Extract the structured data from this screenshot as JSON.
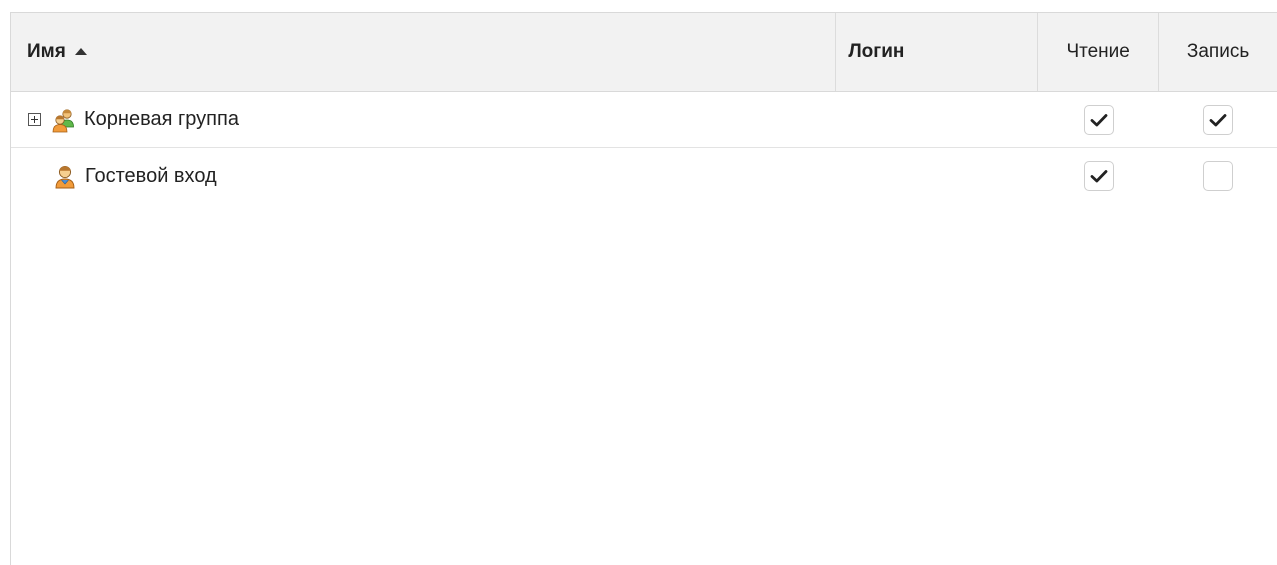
{
  "columns": {
    "name": "Имя",
    "login": "Логин",
    "read": "Чтение",
    "write": "Запись"
  },
  "sort": {
    "column": "name",
    "direction": "ascending"
  },
  "rows": [
    {
      "name": "Корневая группа",
      "type": "group",
      "icon": "user-group-icon",
      "expandable": true,
      "login": "",
      "read": true,
      "write": true
    },
    {
      "name": "Гостевой вход",
      "type": "user",
      "icon": "user-icon",
      "expandable": false,
      "login": "",
      "read": true,
      "write": false
    }
  ]
}
